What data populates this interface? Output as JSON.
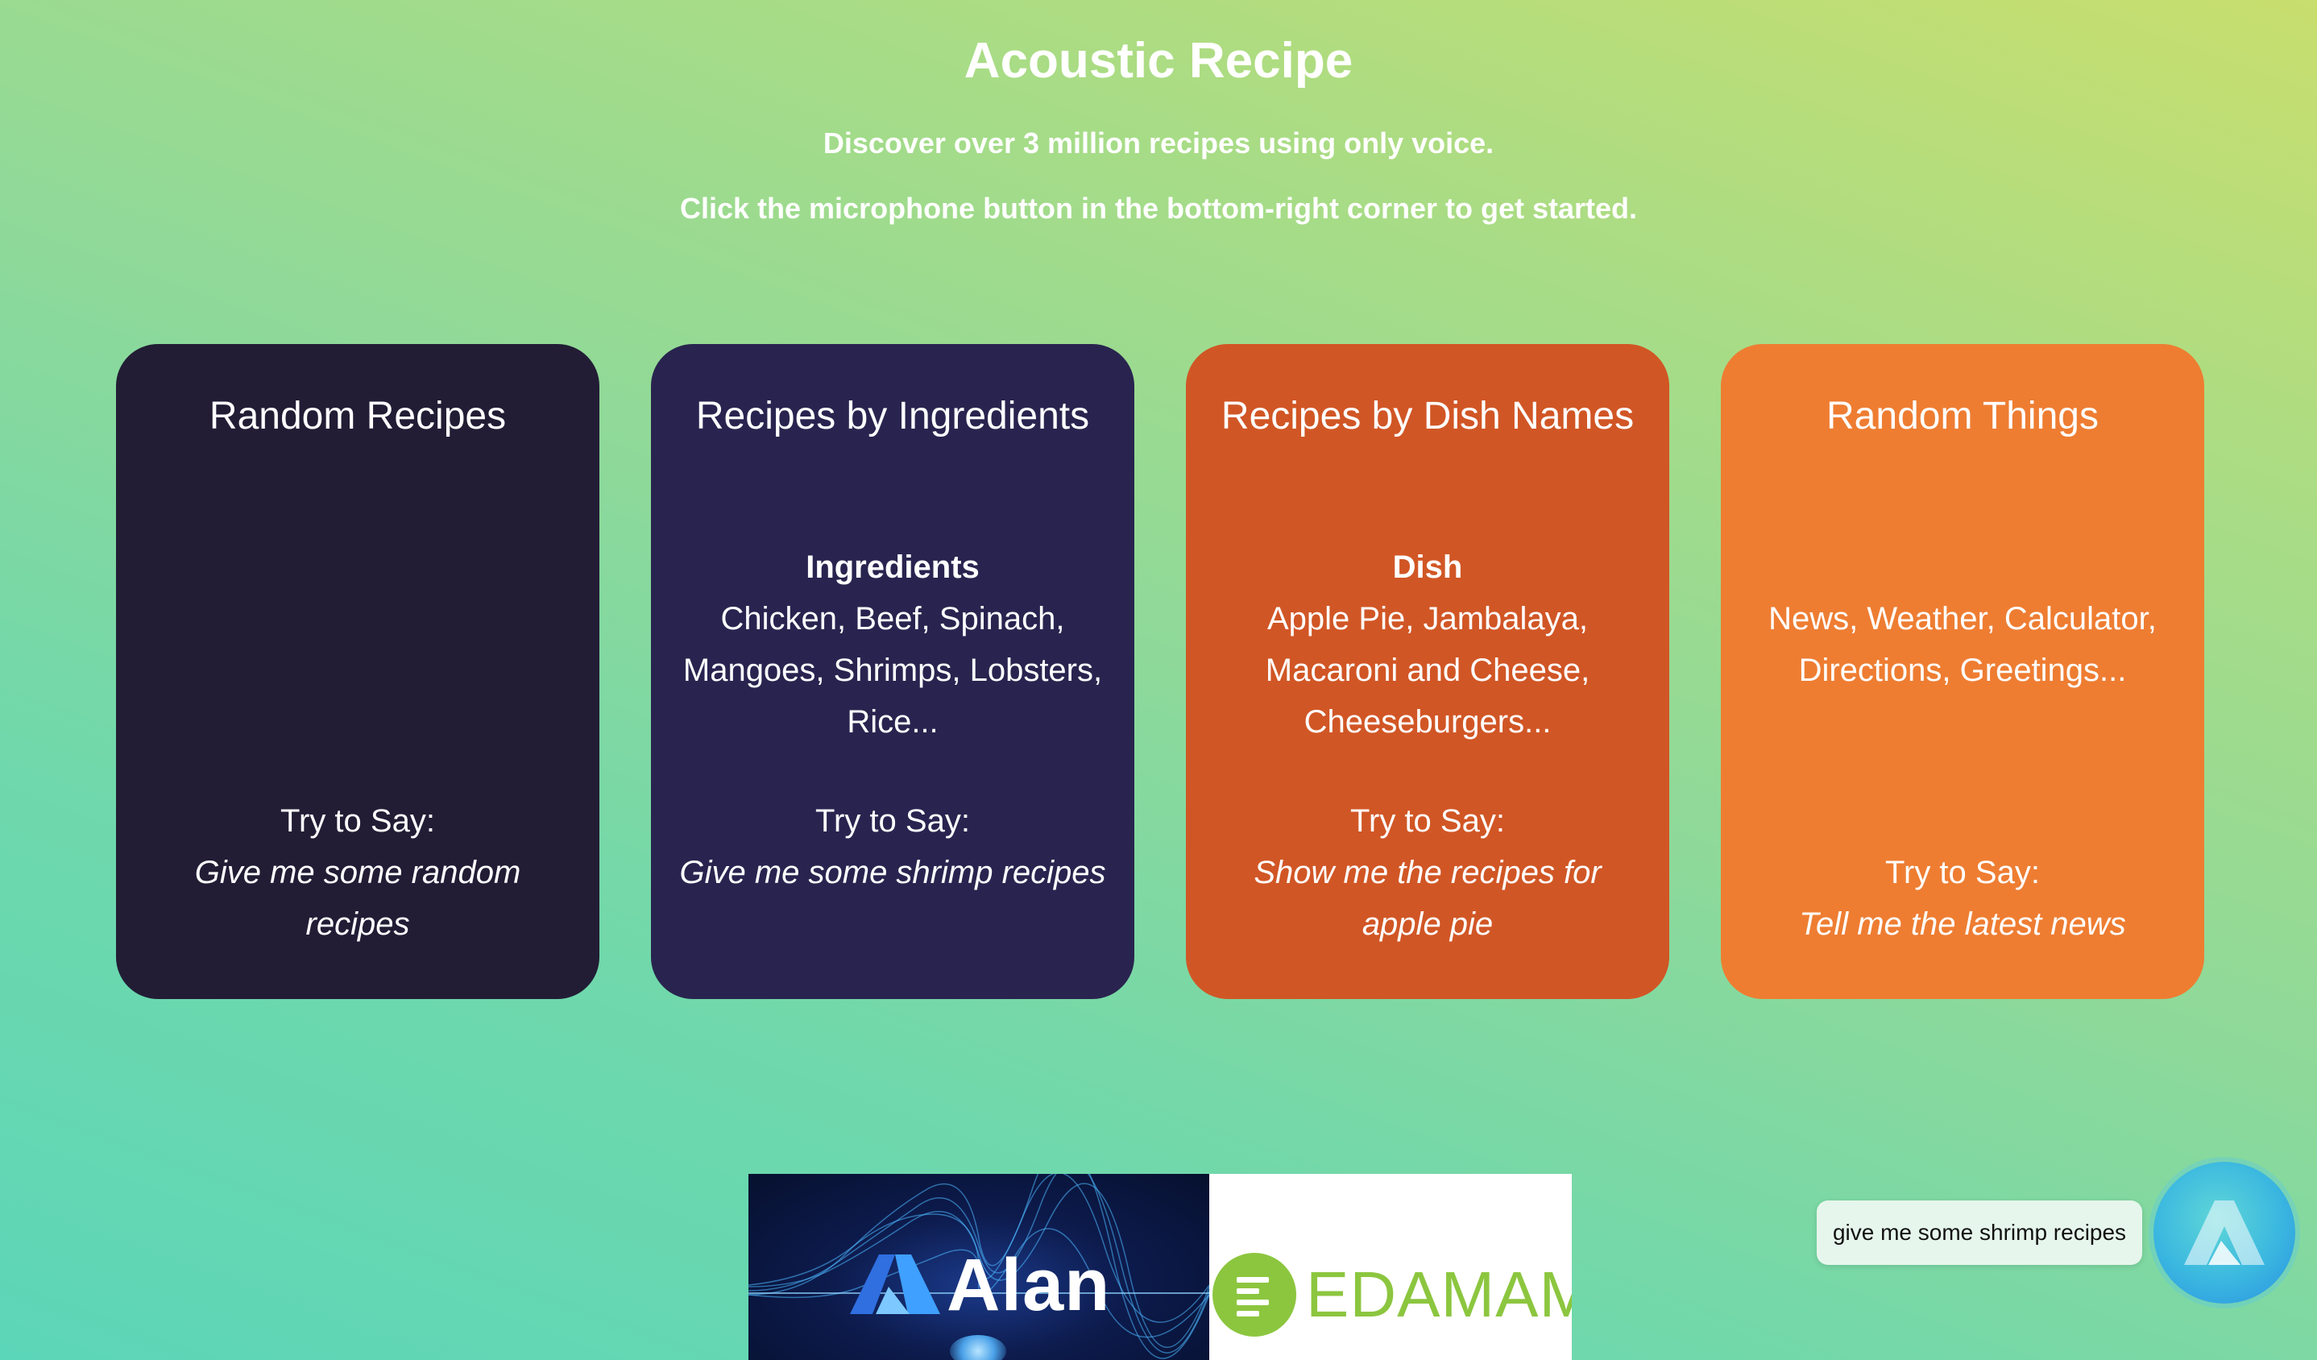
{
  "header": {
    "title": "Acoustic Recipe",
    "subtitle_1": "Discover over 3 million recipes using only voice.",
    "subtitle_2": "Click the microphone button in the bottom-right corner to get started."
  },
  "cards": [
    {
      "title": "Random Recipes",
      "heading": "",
      "items": "",
      "try_label": "Try to Say:",
      "try_phrase": "Give me some random recipes",
      "color": "#221d35"
    },
    {
      "title": "Recipes by Ingredients",
      "heading": "Ingredients",
      "items": "Chicken, Beef, Spinach, Mangoes, Shrimps, Lobsters, Rice...",
      "try_label": "Try to Say:",
      "try_phrase": "Give me some shrimp recipes",
      "color": "#29244f"
    },
    {
      "title": "Recipes by Dish Names",
      "heading": "Dish",
      "items": "Apple Pie, Jambalaya, Macaroni and Cheese, Cheeseburgers...",
      "try_label": "Try to Say:",
      "try_phrase": "Show me the recipes for apple pie",
      "color": "#d15625"
    },
    {
      "title": "Random Things",
      "heading": "",
      "items": "News, Weather, Calculator, Directions, Greetings...",
      "try_label": "Try to Say:",
      "try_phrase": "Tell me the latest news",
      "color": "#ee7d32"
    }
  ],
  "logos": {
    "alan": "Alan",
    "edamam": "EDAMAM"
  },
  "assistant": {
    "transcript": "give me some shrimp recipes",
    "button_icon": "alan-logo-icon"
  },
  "colors": {
    "text": "#ffffff",
    "edamam_green": "#8cc63f",
    "bubble_bg": "#e6f6ec"
  }
}
